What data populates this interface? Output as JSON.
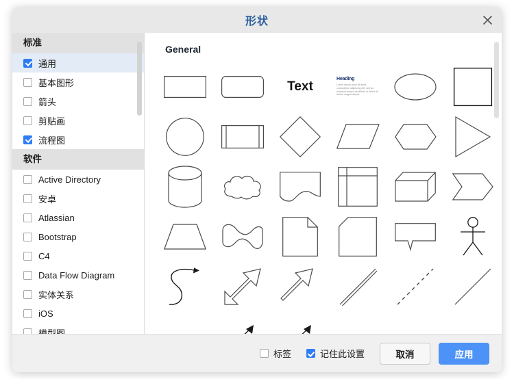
{
  "dialog": {
    "title": "形状",
    "close_icon": "close-icon"
  },
  "sidebar": {
    "scrollbar": {
      "thumb_top_pct": 2,
      "thumb_height_pct": 25
    },
    "groups": [
      {
        "header": "标准",
        "items": [
          {
            "label": "通用",
            "checked": true,
            "selected": true
          },
          {
            "label": "基本图形",
            "checked": false,
            "selected": false
          },
          {
            "label": "箭头",
            "checked": false,
            "selected": false
          },
          {
            "label": "剪贴画",
            "checked": false,
            "selected": false
          },
          {
            "label": "流程图",
            "checked": true,
            "selected": false
          }
        ]
      },
      {
        "header": "软件",
        "items": [
          {
            "label": "Active Directory",
            "checked": false,
            "selected": false
          },
          {
            "label": "安卓",
            "checked": false,
            "selected": false
          },
          {
            "label": "Atlassian",
            "checked": false,
            "selected": false
          },
          {
            "label": "Bootstrap",
            "checked": false,
            "selected": false
          },
          {
            "label": "C4",
            "checked": false,
            "selected": false
          },
          {
            "label": "Data Flow Diagram",
            "checked": false,
            "selected": false
          },
          {
            "label": "实体关系",
            "checked": false,
            "selected": false
          },
          {
            "label": "iOS",
            "checked": false,
            "selected": false
          },
          {
            "label": "模型图",
            "checked": false,
            "selected": false
          }
        ]
      }
    ]
  },
  "canvas": {
    "section_title": "General",
    "scrollbar": {
      "thumb_top_pct": 2,
      "thumb_height_pct": 26
    },
    "text_shape_label": "Text",
    "textbox_shape": {
      "heading": "Heading",
      "body": "Lorem ipsum dolor sit amet, consectetur adipiscing elit, sed do eiusmod tempor incididunt ut labore et dolore magna aliqua."
    },
    "rows": [
      [
        "rectangle",
        "rounded-rectangle",
        "text",
        "textbox",
        "ellipse",
        "square"
      ],
      [
        "circle",
        "process",
        "diamond",
        "parallelogram",
        "hexagon",
        "triangle"
      ],
      [
        "cylinder",
        "cloud",
        "document",
        "internal-storage",
        "cube",
        "step"
      ],
      [
        "trapezoid",
        "tape",
        "note",
        "card",
        "callout",
        "actor"
      ],
      [
        "curved-arrow",
        "double-arrow",
        "block-arrow",
        "double-line",
        "dashed-line",
        "solid-line"
      ],
      [
        "",
        "arrow-up-1",
        "arrow-up-2",
        "",
        "",
        ""
      ]
    ]
  },
  "footer": {
    "tag_checkbox": {
      "label": "标签",
      "checked": false
    },
    "remember_checkbox": {
      "label": "记住此设置",
      "checked": true
    },
    "cancel_label": "取消",
    "apply_label": "应用",
    "apply_color": "#4c92f7"
  }
}
